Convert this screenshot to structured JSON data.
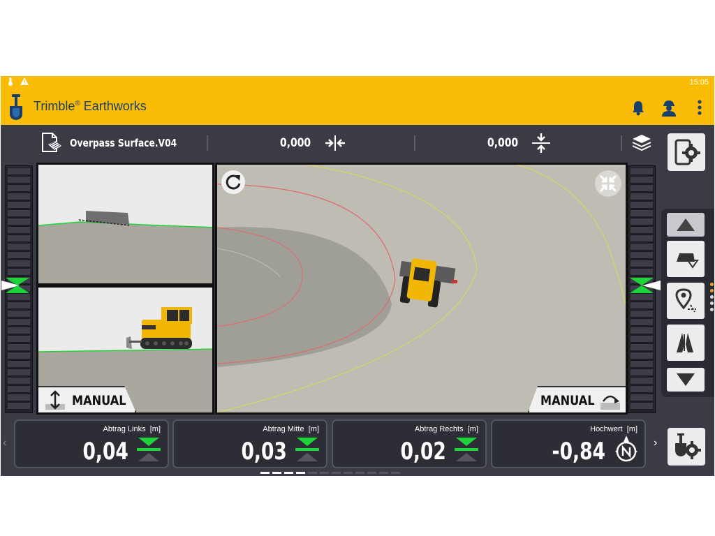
{
  "statusbar": {
    "time": "15:05",
    "icons": [
      "thermometer-icon",
      "warning-icon"
    ]
  },
  "appbar": {
    "title": "Trimble",
    "title_reg": "®",
    "title_suffix": " Earthworks",
    "icons": [
      "bell-icon",
      "operator-icon",
      "more-vert-icon"
    ]
  },
  "infobar": {
    "surface_name": "Overpass Surface.V04",
    "cross_slope_value": "0,000",
    "vertical_value": "0,000"
  },
  "views": {
    "side_manual_label": "MANUAL",
    "plan_manual_label": "MANUAL"
  },
  "cards": [
    {
      "label": "Abtrag Links",
      "unit": "[m]",
      "value": "0,04"
    },
    {
      "label": "Abtrag Mitte",
      "unit": "[m]",
      "value": "0,03"
    },
    {
      "label": "Abtrag Rechts",
      "unit": "[m]",
      "value": "0,02"
    },
    {
      "label": "Hochwert",
      "unit": "[m]",
      "value": "-0,84"
    }
  ],
  "colors": {
    "brand_yellow": "#fbbc05",
    "brand_blue": "#1a3f6b",
    "on_grade_green": "#1fd33a",
    "dark_panel": "#3a3b45"
  },
  "pager": {
    "total": 12,
    "active": [
      0,
      1,
      2,
      3
    ]
  }
}
